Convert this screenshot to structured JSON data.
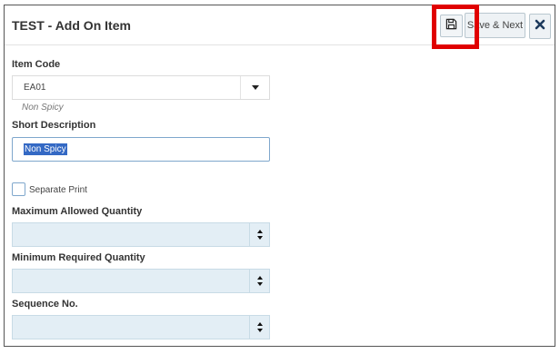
{
  "dialog": {
    "title": "TEST - Add On Item",
    "save_icon": "floppy-disk-icon",
    "save_next_label": "Save & Next",
    "close_icon": "close-x-icon"
  },
  "form": {
    "item_code": {
      "label": "Item Code",
      "value": "EA01",
      "hint": "Non Spicy"
    },
    "short_description": {
      "label": "Short Description",
      "value": "Non Spicy"
    },
    "separate_print": {
      "label": "Separate Print",
      "checked": false
    },
    "maximum_allowed_quantity": {
      "label": "Maximum Allowed Quantity",
      "value": ""
    },
    "minimum_required_quantity": {
      "label": "Minimum Required Quantity",
      "value": ""
    },
    "sequence_no": {
      "label": "Sequence No.",
      "value": ""
    }
  },
  "colors": {
    "highlight": "#e00000",
    "selection": "#3469c4"
  }
}
